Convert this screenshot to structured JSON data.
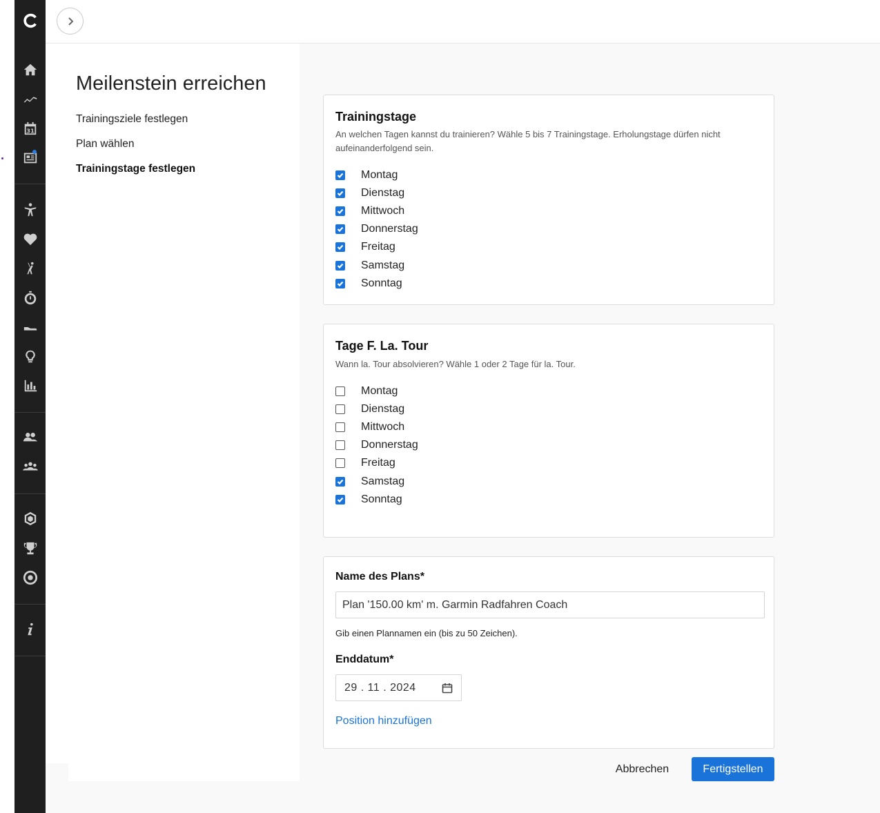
{
  "wizard": {
    "title": "Meilenstein erreichen",
    "steps": [
      "Trainingsziele festlegen",
      "Plan wählen",
      "Trainingstage festlegen"
    ],
    "active_step": 2
  },
  "training_days": {
    "title": "Trainingstage",
    "description": "An welchen Tagen kannst du trainieren? Wähle 5 bis 7 Trainingstage. Erholungstage dürfen nicht aufeinanderfolgend sein.",
    "days": [
      {
        "label": "Montag",
        "checked": true
      },
      {
        "label": "Dienstag",
        "checked": true
      },
      {
        "label": "Mittwoch",
        "checked": true
      },
      {
        "label": "Donnerstag",
        "checked": true
      },
      {
        "label": "Freitag",
        "checked": true
      },
      {
        "label": "Samstag",
        "checked": true
      },
      {
        "label": "Sonntag",
        "checked": true
      }
    ]
  },
  "long_tour": {
    "title": "Tage F. La. Tour",
    "description": "Wann la. Tour absolvieren? Wähle 1 oder 2 Tage für la. Tour.",
    "days": [
      {
        "label": "Montag",
        "checked": false
      },
      {
        "label": "Dienstag",
        "checked": false
      },
      {
        "label": "Mittwoch",
        "checked": false
      },
      {
        "label": "Donnerstag",
        "checked": false
      },
      {
        "label": "Freitag",
        "checked": false
      },
      {
        "label": "Samstag",
        "checked": true
      },
      {
        "label": "Sonntag",
        "checked": true
      }
    ]
  },
  "plan": {
    "name_label": "Name des Plans*",
    "name_value": "Plan '150.00 km' m. Garmin Radfahren Coach",
    "name_hint": "Gib einen Plannamen ein (bis zu 50 Zeichen).",
    "end_label": "Enddatum*",
    "end_value": "29 . 11 . 2024",
    "add_position": "Position hinzufügen"
  },
  "actions": {
    "cancel": "Abbrechen",
    "finish": "Fertigstellen"
  },
  "colors": {
    "accent": "#1a73d9",
    "rail": "#1f1f1f",
    "notification_dot": "#2a7de1"
  },
  "rail_icons": [
    "garmin-logo-icon",
    "home-icon",
    "activity-chart-icon",
    "calendar-icon",
    "news-icon",
    "body-icon",
    "heart-icon",
    "golf-icon",
    "stopwatch-icon",
    "shoe-icon",
    "lightbulb-icon",
    "bar-chart-icon",
    "connections-icon",
    "groups-icon",
    "badge-icon",
    "trophy-icon",
    "target-icon",
    "info-icon"
  ],
  "calendar_day": "31"
}
